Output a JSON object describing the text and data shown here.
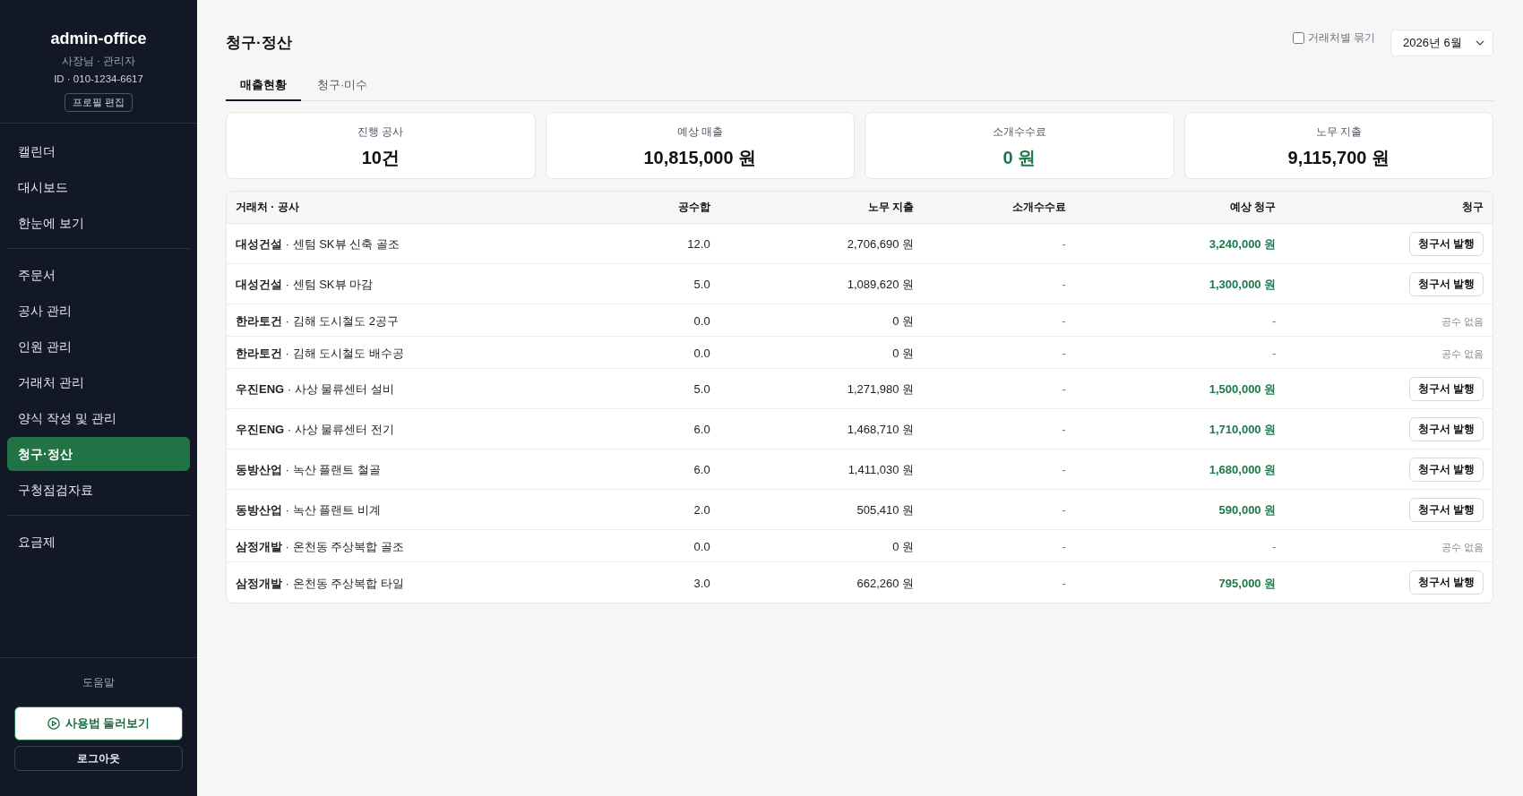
{
  "sidebar": {
    "profile": {
      "name": "admin-office",
      "role": "사장님 · 관리자",
      "account_id": "ID · 010-1234-6617",
      "edit_button": "프로필 편집"
    },
    "nav_groups": [
      {
        "items": [
          {
            "label": "캘린더",
            "selected": false
          },
          {
            "label": "대시보드",
            "selected": false
          },
          {
            "label": "한눈에 보기",
            "selected": false
          }
        ]
      },
      {
        "items": [
          {
            "label": "주문서",
            "selected": false
          },
          {
            "label": "공사 관리",
            "selected": false
          },
          {
            "label": "인원 관리",
            "selected": false
          },
          {
            "label": "거래처 관리",
            "selected": false
          },
          {
            "label": "양식 작성 및 관리",
            "selected": false
          },
          {
            "label": "청구·정산",
            "selected": true
          },
          {
            "label": "구청점검자료",
            "selected": false
          }
        ]
      },
      {
        "items": [
          {
            "label": "요금제",
            "selected": false
          }
        ]
      }
    ],
    "help_label": "도움말",
    "tour_button": "사용법 둘러보기",
    "logout_button": "로그아웃"
  },
  "page": {
    "title": "청구·정산",
    "group_by_client": {
      "label": "거래처별 묶기",
      "checked": false
    },
    "month_select": {
      "value": "2026년 6월"
    }
  },
  "tabs": [
    {
      "label": "매출현황",
      "selected": true
    },
    {
      "label": "청구·미수",
      "selected": false
    }
  ],
  "stats": [
    {
      "label": "진행 공사",
      "value": "10건",
      "kind": "plain"
    },
    {
      "label": "예상 매출",
      "value": "10,815,000 원",
      "kind": "plain"
    },
    {
      "label": "소개수수료",
      "value": "0 원",
      "kind": "accent"
    },
    {
      "label": "노무 지출",
      "value": "9,115,700 원",
      "kind": "plain"
    }
  ],
  "table": {
    "columns": [
      "거래처 · 공사",
      "공수합",
      "노무 지출",
      "소개수수료",
      "예상 청구",
      "청구"
    ],
    "rows": [
      {
        "name": "**대성건설** · 센텀 SK뷰 신축 골조",
        "man_days": "12.0",
        "labor_cost": "2,706,690 원",
        "referral_fee": "-",
        "expected_billing": {
          "kind": "amount",
          "text": "3,240,000 원"
        },
        "billing": {
          "kind": "button",
          "text": "청구서 발행"
        }
      },
      {
        "name": "**대성건설** · 센텀 SK뷰 마감",
        "man_days": "5.0",
        "labor_cost": "1,089,620 원",
        "referral_fee": "-",
        "expected_billing": {
          "kind": "amount",
          "text": "1,300,000 원"
        },
        "billing": {
          "kind": "button",
          "text": "청구서 발행"
        }
      },
      {
        "name": "**한라토건** · 김해 도시철도 2공구",
        "man_days": "0.0",
        "labor_cost": "0 원",
        "referral_fee": "-",
        "expected_billing": {
          "kind": "none",
          "text": "-"
        },
        "billing": {
          "kind": "note",
          "text": "공수 없음"
        }
      },
      {
        "name": "**한라토건** · 김해 도시철도 배수공",
        "man_days": "0.0",
        "labor_cost": "0 원",
        "referral_fee": "-",
        "expected_billing": {
          "kind": "none",
          "text": "-"
        },
        "billing": {
          "kind": "note",
          "text": "공수 없음"
        }
      },
      {
        "name": "**우진ENG** · 사상 물류센터 설비",
        "man_days": "5.0",
        "labor_cost": "1,271,980 원",
        "referral_fee": "-",
        "expected_billing": {
          "kind": "amount",
          "text": "1,500,000 원"
        },
        "billing": {
          "kind": "button",
          "text": "청구서 발행"
        }
      },
      {
        "name": "**우진ENG** · 사상 물류센터 전기",
        "man_days": "6.0",
        "labor_cost": "1,468,710 원",
        "referral_fee": "-",
        "expected_billing": {
          "kind": "amount",
          "text": "1,710,000 원"
        },
        "billing": {
          "kind": "button",
          "text": "청구서 발행"
        }
      },
      {
        "name": "**동방산업** · 녹산 플랜트 철골",
        "man_days": "6.0",
        "labor_cost": "1,411,030 원",
        "referral_fee": "-",
        "expected_billing": {
          "kind": "amount",
          "text": "1,680,000 원"
        },
        "billing": {
          "kind": "button",
          "text": "청구서 발행"
        }
      },
      {
        "name": "**동방산업** · 녹산 플랜트 비계",
        "man_days": "2.0",
        "labor_cost": "505,410 원",
        "referral_fee": "-",
        "expected_billing": {
          "kind": "amount",
          "text": "590,000 원"
        },
        "billing": {
          "kind": "button",
          "text": "청구서 발행"
        }
      },
      {
        "name": "**삼정개발** · 온천동 주상복합 골조",
        "man_days": "0.0",
        "labor_cost": "0 원",
        "referral_fee": "-",
        "expected_billing": {
          "kind": "none",
          "text": "-"
        },
        "billing": {
          "kind": "note",
          "text": "공수 없음"
        }
      },
      {
        "name": "**삼정개발** · 온천동 주상복합 타일",
        "man_days": "3.0",
        "labor_cost": "662,260 원",
        "referral_fee": "-",
        "expected_billing": {
          "kind": "amount",
          "text": "795,000 원"
        },
        "billing": {
          "kind": "button",
          "text": "청구서 발행"
        }
      }
    ]
  }
}
